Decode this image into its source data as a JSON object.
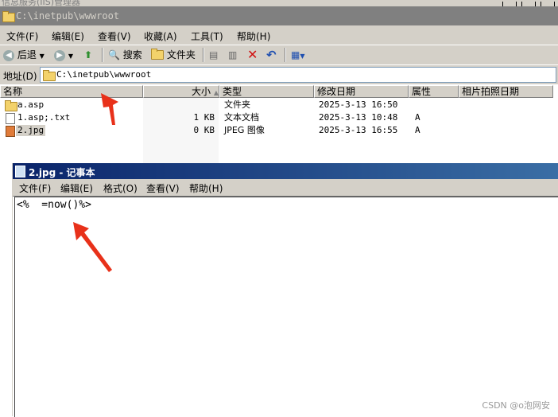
{
  "background_window": {
    "title": "信息服务(IIS)管理器"
  },
  "explorer": {
    "title": "C:\\inetpub\\wwwroot",
    "menu": [
      "文件(F)",
      "编辑(E)",
      "查看(V)",
      "收藏(A)",
      "工具(T)",
      "帮助(H)"
    ],
    "toolbar": {
      "back_label": "后退",
      "search_label": "搜索",
      "folders_label": "文件夹"
    },
    "address": {
      "label": "地址(D)",
      "value": "C:\\inetpub\\wwwroot"
    },
    "columns": [
      "名称",
      "大小",
      "类型",
      "修改日期",
      "属性",
      "相片拍照日期"
    ],
    "files": [
      {
        "name": "a.asp",
        "size": "",
        "type": "文件夹",
        "modified": "2025-3-13 16:50",
        "attr": "",
        "icon": "folder-icon"
      },
      {
        "name": "1.asp;.txt",
        "size": "1 KB",
        "type": "文本文档",
        "modified": "2025-3-13 10:48",
        "attr": "A",
        "icon": "text-file-icon"
      },
      {
        "name": "2.jpg",
        "size": "0 KB",
        "type": "JPEG 图像",
        "modified": "2025-3-13 16:55",
        "attr": "A",
        "icon": "image-file-icon"
      }
    ]
  },
  "notepad": {
    "title": "2.jpg - 记事本",
    "menu": [
      "文件(F)",
      "编辑(E)",
      "格式(O)",
      "查看(V)",
      "帮助(H)"
    ],
    "content": "<%  =now()%>"
  },
  "watermark": "CSDN @o泡网安",
  "colors": {
    "explorer_titlebar": "#808080",
    "notepad_titlebar": "#0a246a",
    "chrome": "#d4d0c8",
    "arrow": "#e8311a"
  }
}
